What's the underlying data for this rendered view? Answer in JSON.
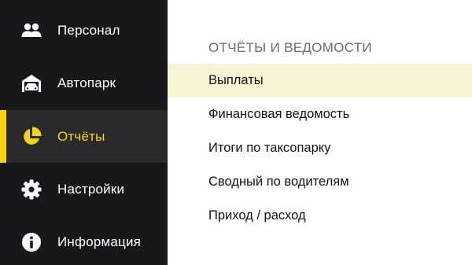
{
  "sidebar": {
    "accent_color": "#f7d50e",
    "background": "#18181b",
    "items": [
      {
        "label": "Персонал",
        "icon": "people-icon"
      },
      {
        "label": "Автопарк",
        "icon": "garage-car-icon"
      },
      {
        "label": "Отчёты",
        "icon": "pie-chart-icon",
        "active": true
      },
      {
        "label": "Настройки",
        "icon": "gear-icon"
      },
      {
        "label": "Информация",
        "icon": "info-icon"
      }
    ]
  },
  "main": {
    "section_title": "ОТЧЁТЫ И ВЕДОМОСТИ",
    "highlight_color": "#f5f4d3",
    "reports": [
      {
        "label": "Выплаты",
        "selected": true
      },
      {
        "label": "Финансовая ведомость"
      },
      {
        "label": "Итоги по таксопарку"
      },
      {
        "label": "Сводный по водителям"
      },
      {
        "label": "Приход / расход"
      }
    ]
  }
}
